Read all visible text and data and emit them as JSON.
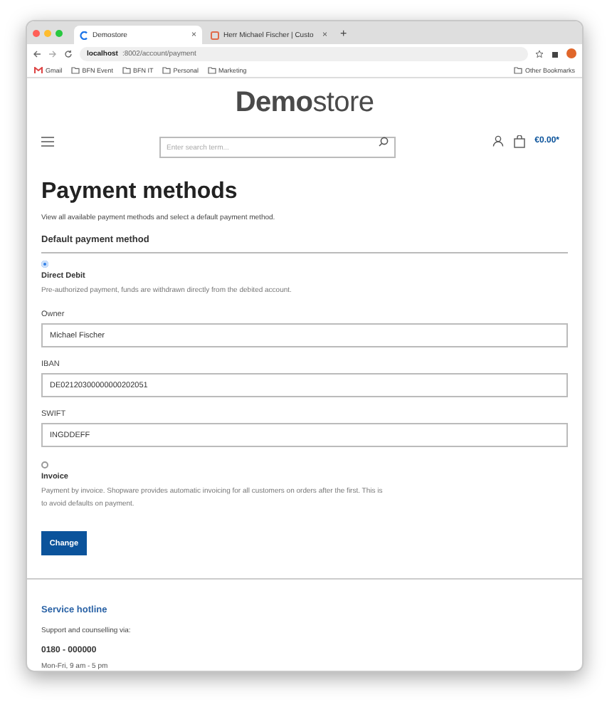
{
  "browser": {
    "tabs": [
      {
        "title": "Demostore",
        "selected": true,
        "close": "×"
      },
      {
        "title": "Herr Michael Fischer | Custo",
        "selected": false,
        "close": "×"
      }
    ],
    "new_tab": "+",
    "url": {
      "host": "localhost",
      "path": ":8002/account/payment"
    },
    "bookmarks": [
      {
        "label": "Gmail",
        "kind": "mail"
      },
      {
        "label": "BFN Event",
        "kind": "folder"
      },
      {
        "label": "BFN IT",
        "kind": "folder"
      },
      {
        "label": "Personal",
        "kind": "folder"
      },
      {
        "label": "Marketing",
        "kind": "folder"
      }
    ],
    "other_bookmarks": "Other Bookmarks"
  },
  "header": {
    "logo": "**Demo**store",
    "search": {
      "placeholder": "Enter search term..."
    },
    "cart_total": "€0.00*"
  },
  "page": {
    "title": "Payment methods",
    "subtitle": "View all available payment methods and select a default payment method.",
    "section": "Default payment method",
    "methods": [
      {
        "name": "Direct Debit",
        "selected": true,
        "description": "Pre-authorized payment, funds are withdrawn directly from the debited account.",
        "fields": [
          {
            "label": "Owner",
            "value": "Michael Fischer"
          },
          {
            "label": "IBAN",
            "value": "DE02120300000000202051"
          },
          {
            "label": "SWIFT",
            "value": "INGDDEFF"
          }
        ]
      },
      {
        "name": "Invoice",
        "selected": false,
        "description": "Payment by invoice. Shopware provides automatic invoicing for all customers on orders after the first. This is to avoid defaults on payment."
      }
    ],
    "button": "Change"
  },
  "footer": {
    "title": "Service hotline",
    "text": "Support and counselling via:",
    "phone": "0180 - 000000",
    "hours": "Mon-Fri, 9 am - 5 pm"
  }
}
